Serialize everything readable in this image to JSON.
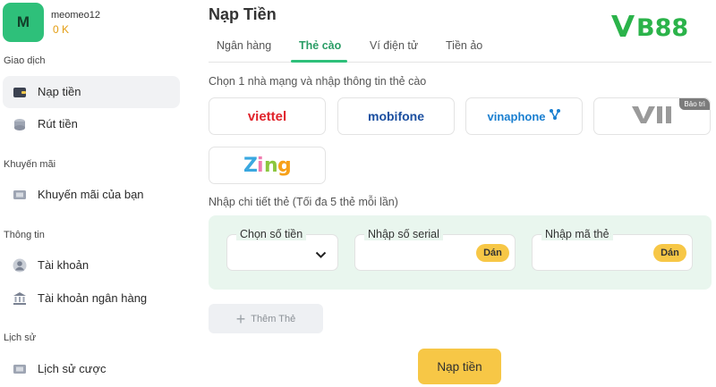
{
  "user": {
    "avatar_letter": "M",
    "name": "meomeo12",
    "balance": "0 K"
  },
  "sidebar": {
    "sections": [
      {
        "label": "Giao dịch"
      },
      {
        "label": "Khuyến mãi"
      },
      {
        "label": "Thông tin"
      },
      {
        "label": "Lịch sử"
      }
    ],
    "items": [
      {
        "label": "Nạp tiền",
        "icon": "wallet-icon"
      },
      {
        "label": "Rút tiền",
        "icon": "money-stack-icon"
      },
      {
        "label": "Khuyến mãi của bạn",
        "icon": "ticket-icon"
      },
      {
        "label": "Tài khoản",
        "icon": "user-icon"
      },
      {
        "label": "Tài khoản ngân hàng",
        "icon": "bank-icon"
      },
      {
        "label": "Lịch sử cược",
        "icon": "ticket-history-icon"
      }
    ]
  },
  "main": {
    "title": "Nạp Tiền",
    "tabs": [
      {
        "label": "Ngân hàng"
      },
      {
        "label": "Thẻ cào"
      },
      {
        "label": "Ví điện tử"
      },
      {
        "label": "Tiền ảo"
      }
    ],
    "active_tab": "Thẻ cào",
    "carrier_prompt": "Chọn 1 nhà mạng và nhập thông tin thẻ cào",
    "carriers": [
      {
        "name": "viettel",
        "color": "#e0232b"
      },
      {
        "name": "mobifone",
        "color": "#1b4fa0"
      },
      {
        "name": "vinaphone",
        "color": "#1a7fd0"
      },
      {
        "name": "Vietnamobile",
        "color": "#9a9a9a",
        "badge": "Bảo trì"
      },
      {
        "name": "Zing",
        "color": "#3aa8e0"
      }
    ],
    "detail_prompt": "Nhập chi tiết thẻ (Tối đa 5 thẻ mỗi lần)",
    "fields": {
      "amount_label": "Chọn số tiền",
      "serial_label": "Nhập số serial",
      "code_label": "Nhập mã thẻ",
      "paste_label": "Dán"
    },
    "add_card_label": "Thêm Thẻ",
    "submit_label": "Nạp tiền"
  },
  "brand": {
    "logo_text": "VB88",
    "color": "#2bb34a"
  },
  "colors": {
    "accent": "#2ec07a",
    "button": "#f7c746",
    "balance": "#e39d12"
  }
}
